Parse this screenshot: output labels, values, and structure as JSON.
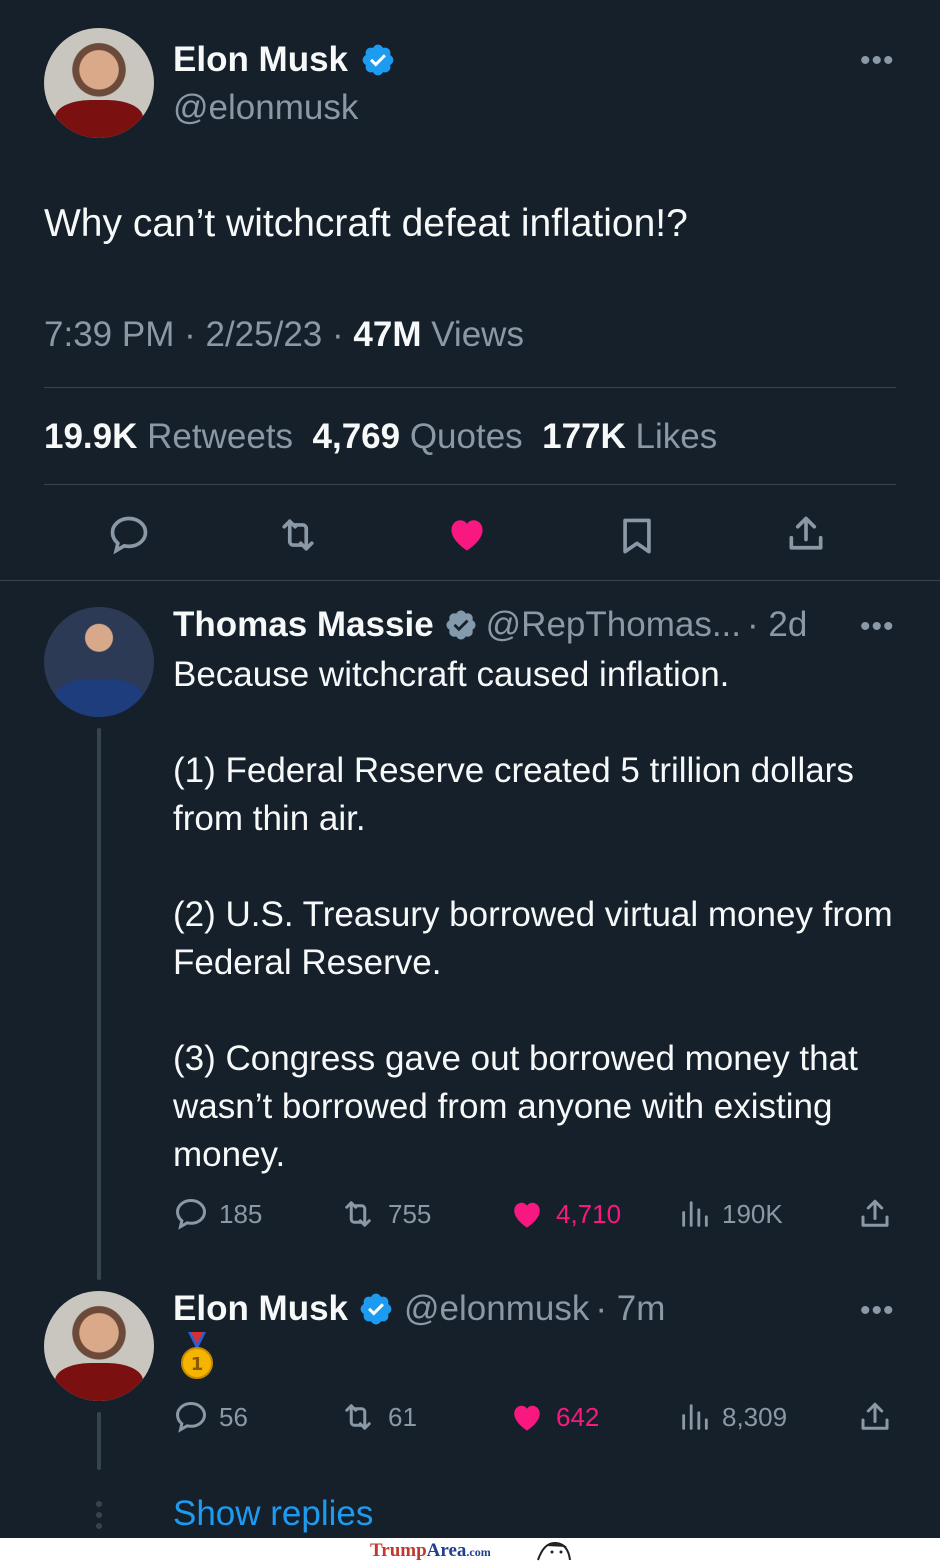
{
  "main_tweet": {
    "author_name": "Elon Musk",
    "author_handle": "@elonmusk",
    "text": "Why can’t witchcraft defeat inflation!?",
    "time": "7:39 PM",
    "date": "2/25/23",
    "views_count": "47M",
    "views_label": "Views",
    "retweets_count": "19.9K",
    "retweets_label": "Retweets",
    "quotes_count": "4,769",
    "quotes_label": "Quotes",
    "likes_count": "177K",
    "likes_label": "Likes",
    "sep": "·"
  },
  "reply1": {
    "author_name": "Thomas Massie",
    "author_handle": "@RepThomas...",
    "age": "· 2d",
    "text": "Because witchcraft caused inflation.\n\n(1) Federal Reserve created 5 trillion dollars from thin air.\n\n(2) U.S. Treasury borrowed virtual money from Federal Reserve.\n\n(3) Congress gave out borrowed money that wasn’t borrowed from anyone with existing money.",
    "replies": "185",
    "retweets": "755",
    "likes": "4,710",
    "views": "190K"
  },
  "reply2": {
    "author_name": "Elon Musk",
    "author_handle": "@elonmusk",
    "age": "· 7m",
    "text": "🥇",
    "replies": "56",
    "retweets": "61",
    "likes": "642",
    "views": "8,309"
  },
  "show_replies": "Show replies",
  "watermark": {
    "brand_trump": "Trump",
    "brand_area": "Area",
    "brand_com": ".com"
  },
  "colors": {
    "background": "#15202b",
    "accent_blue": "#1d9bf0",
    "like_pink": "#f91880",
    "muted": "#8b98a5",
    "divider": "#38444d"
  }
}
